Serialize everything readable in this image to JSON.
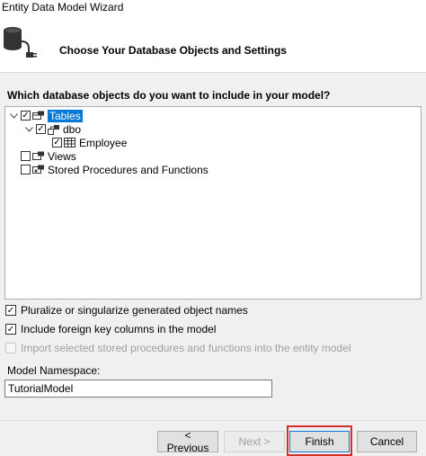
{
  "window": {
    "title": "Entity Data Model Wizard"
  },
  "header": {
    "heading": "Choose Your Database Objects and Settings"
  },
  "question": "Which database objects do you want to include in your model?",
  "tree": {
    "tables": {
      "label": "Tables",
      "checked": true,
      "expanded": true
    },
    "dbo": {
      "label": "dbo",
      "checked": true,
      "expanded": true
    },
    "employee": {
      "label": "Employee",
      "checked": true
    },
    "views": {
      "label": "Views",
      "checked": false
    },
    "procs": {
      "label": "Stored Procedures and Functions",
      "checked": false
    }
  },
  "options": {
    "pluralize": {
      "label": "Pluralize or singularize generated object names",
      "checked": true
    },
    "foreign_keys": {
      "label": "Include foreign key columns in the model",
      "checked": true
    },
    "import_procs": {
      "label": "Import selected stored procedures and functions into the entity model",
      "checked": false,
      "enabled": false
    }
  },
  "namespace": {
    "label": "Model Namespace:",
    "value": "TutorialModel"
  },
  "buttons": {
    "previous": "< Previous",
    "next": "Next >",
    "finish": "Finish",
    "cancel": "Cancel"
  },
  "colors": {
    "selection": "#0078d7",
    "highlight": "#d32f2f"
  }
}
